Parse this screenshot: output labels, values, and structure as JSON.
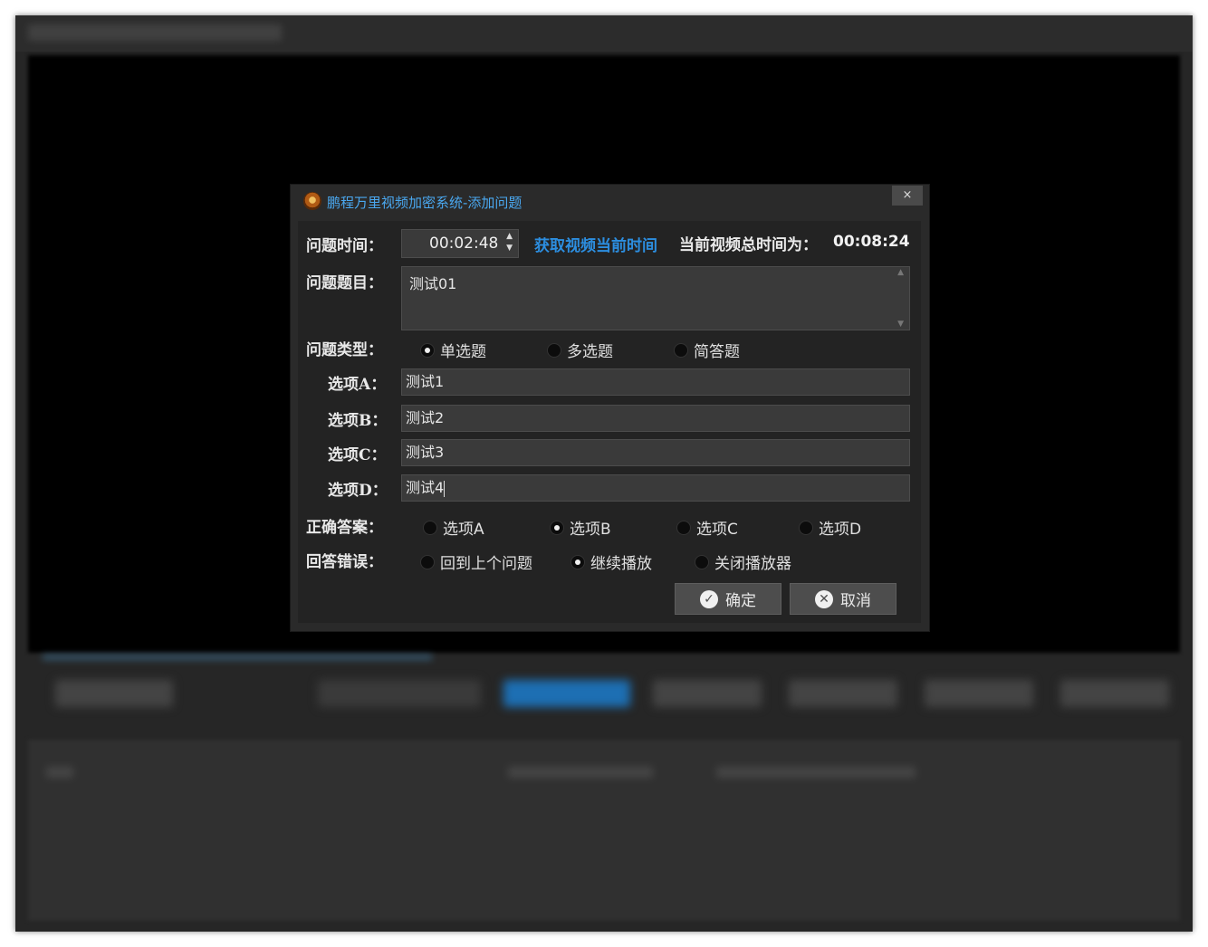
{
  "dialog": {
    "title": "鹏程万里视频加密系统-添加问题",
    "close_label": "×"
  },
  "question_time": {
    "label": "问题时间：",
    "value": "00:02:48",
    "get_current_label": "获取视频当前时间",
    "total_label": "当前视频总时间为：",
    "total_value": "00:08:24"
  },
  "question_title": {
    "label": "问题题目：",
    "value": "测试01"
  },
  "question_type": {
    "label": "问题类型：",
    "options": [
      "单选题",
      "多选题",
      "简答题"
    ],
    "selected": "单选题"
  },
  "options": {
    "a_label": "选项A：",
    "a_value": "测试1",
    "b_label": "选项B：",
    "b_value": "测试2",
    "c_label": "选项C：",
    "c_value": "测试3",
    "d_label": "选项D：",
    "d_value": "测试4"
  },
  "correct_answer": {
    "label": "正确答案：",
    "options": [
      "选项A",
      "选项B",
      "选项C",
      "选项D"
    ],
    "selected": "选项B"
  },
  "wrong_answer": {
    "label": "回答错误：",
    "options": [
      "回到上个问题",
      "继续播放",
      "关闭播放器"
    ],
    "selected": "继续播放"
  },
  "buttons": {
    "ok_label": "确定",
    "cancel_label": "取消"
  },
  "icons": {
    "ok": "check-circle-icon",
    "cancel": "x-circle-icon",
    "app": "app-logo-icon"
  }
}
